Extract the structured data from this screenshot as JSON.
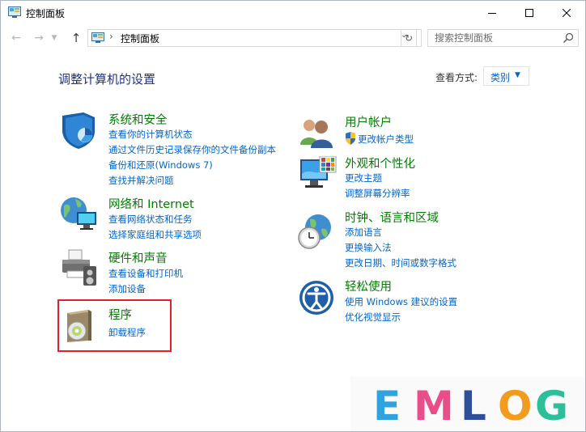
{
  "window": {
    "title": "控制面板"
  },
  "address": {
    "path": "控制面板",
    "separator": "›",
    "search_placeholder": "搜索控制面板"
  },
  "main": {
    "heading": "调整计算机的设置",
    "view_by_label": "查看方式:",
    "view_by_value": "类别"
  },
  "categories": [
    {
      "title": "系统和安全",
      "icon": "security-shield-icon",
      "links": [
        "查看你的计算机状态",
        "通过文件历史记录保存你的文件备份副本",
        "备份和还原(Windows 7)",
        "查找并解决问题"
      ]
    },
    {
      "title": "网络和 Internet",
      "icon": "network-globe-icon",
      "links": [
        "查看网络状态和任务",
        "选择家庭组和共享选项"
      ]
    },
    {
      "title": "硬件和声音",
      "icon": "printer-speaker-icon",
      "links": [
        "查看设备和打印机",
        "添加设备"
      ]
    },
    {
      "title": "程序",
      "icon": "programs-disc-icon",
      "links": [
        "卸载程序"
      ]
    },
    {
      "title": "用户帐户",
      "icon": "users-icon",
      "links": [
        "更改帐户类型"
      ]
    },
    {
      "title": "外观和个性化",
      "icon": "monitor-palette-icon",
      "links": [
        "更改主题",
        "调整屏幕分辨率"
      ]
    },
    {
      "title": "时钟、语言和区域",
      "icon": "clock-globe-icon",
      "links": [
        "添加语言",
        "更换输入法",
        "更改日期、时间或数字格式"
      ]
    },
    {
      "title": "轻松使用",
      "icon": "ease-of-access-icon",
      "links": [
        "使用 Windows 建议的设置",
        "优化视觉显示"
      ]
    }
  ],
  "watermark": {
    "letters": [
      "E",
      "M",
      "L",
      "O",
      "G"
    ],
    "colors": [
      "#2ea3e0",
      "#e94e8a",
      "#2f4f9c",
      "#f39b1e",
      "#2dbf9a"
    ]
  }
}
